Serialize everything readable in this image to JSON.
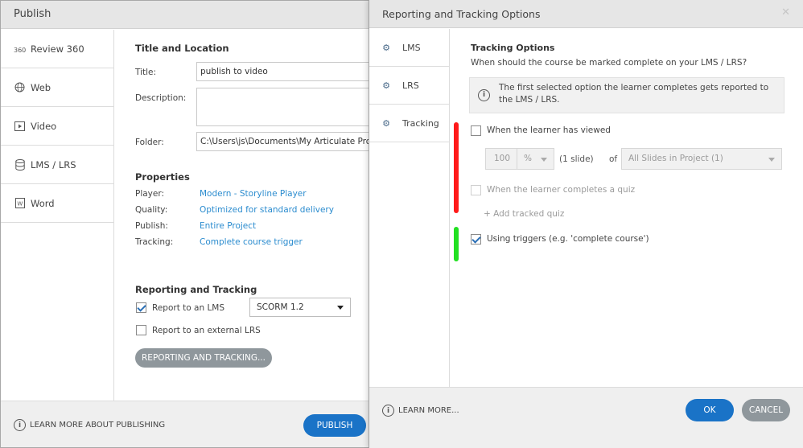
{
  "publish": {
    "title": "Publish",
    "nav": [
      {
        "label": "Review 360",
        "icon": "review-360-icon"
      },
      {
        "label": "Web",
        "icon": "globe-icon"
      },
      {
        "label": "Video",
        "icon": "video-icon"
      },
      {
        "label": "LMS / LRS",
        "icon": "database-icon"
      },
      {
        "label": "Word",
        "icon": "word-doc-icon"
      }
    ],
    "active_nav": "LMS / LRS",
    "title_location": {
      "heading": "Title and Location",
      "title_label": "Title:",
      "title_value": "publish to video",
      "description_label": "Description:",
      "description_value": "",
      "folder_label": "Folder:",
      "folder_value": "C:\\Users\\js\\Documents\\My Articulate Projects"
    },
    "properties": {
      "heading": "Properties",
      "player_label": "Player:",
      "player_value": "Modern - Storyline Player",
      "quality_label": "Quality:",
      "quality_value": "Optimized for standard delivery",
      "publish_label": "Publish:",
      "publish_value": "Entire Project",
      "tracking_label": "Tracking:",
      "tracking_value": "Complete course trigger"
    },
    "reporting": {
      "heading": "Reporting and Tracking",
      "lms_label": "Report to an LMS",
      "lms_checked": true,
      "lms_standard": "SCORM 1.2",
      "lrs_label": "Report to an external LRS",
      "lrs_checked": false,
      "button_label": "REPORTING AND TRACKING..."
    },
    "footer": {
      "learn_more": "LEARN MORE ABOUT PUBLISHING",
      "publish_button": "PUBLISH"
    }
  },
  "reporting_dialog": {
    "title": "Reporting and Tracking Options",
    "close_glyph": "✕",
    "nav": [
      "LMS",
      "LRS",
      "Tracking"
    ],
    "active_nav": "Tracking",
    "tracking": {
      "heading": "Tracking Options",
      "question": "When should the course be marked complete on your LMS / LRS?",
      "info": "The first selected option the learner completes gets reported to the LMS / LRS.",
      "viewed_label": "When the learner has viewed",
      "viewed_checked": false,
      "viewed_amount": "100",
      "viewed_unit": "%",
      "viewed_slides": "(1 slide)",
      "of_label": "of",
      "scope_value": "All Slides in Project (1)",
      "quiz_label": "When the learner completes a quiz",
      "quiz_checked": false,
      "add_quiz_label": "+ Add tracked quiz",
      "triggers_label": "Using triggers (e.g. 'complete course')",
      "triggers_checked": true
    },
    "footer": {
      "learn_more": "LEARN MORE...",
      "ok_button": "OK",
      "cancel_button": "CANCEL"
    }
  },
  "colors": {
    "accent_blue": "#1a73c7",
    "link_blue": "#2b8ccf",
    "marker_red": "#ff1a1a",
    "marker_green": "#22e022",
    "gray_button": "#8f979c"
  }
}
